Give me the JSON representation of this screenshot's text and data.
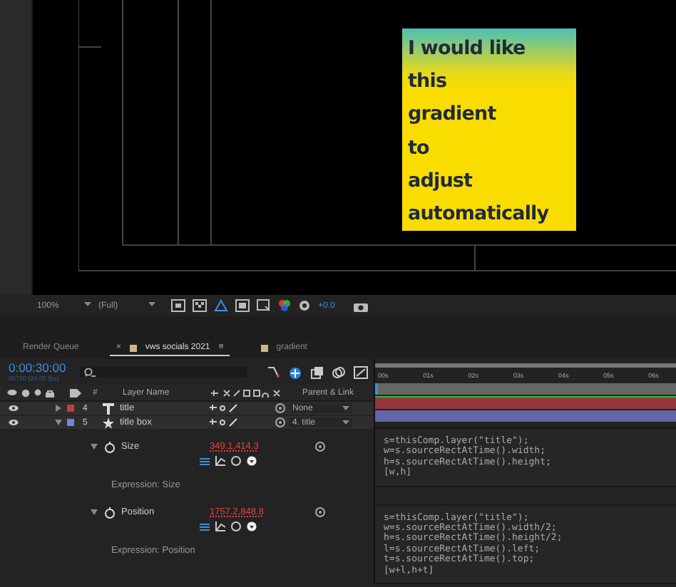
{
  "canvas": {
    "title_card": {
      "lines": [
        "I would like",
        "this",
        "gradient",
        "to",
        "adjust",
        "automatically"
      ]
    }
  },
  "viewer_bar": {
    "zoom": "100%",
    "resolution": "(Full)",
    "exposure": "+0.0"
  },
  "tabs": [
    {
      "label": "Render Queue",
      "selected": false
    },
    {
      "label": "vws socials 2021",
      "selected": true,
      "close": "×",
      "menu": "≡"
    },
    {
      "label": "gradient",
      "selected": false
    }
  ],
  "timecode": "0:00:30:00",
  "frame_info": "00720 (24.00 fps)",
  "columns": [
    "#",
    "Layer Name",
    "Parent & Link"
  ],
  "ruler": [
    "00s",
    "01s",
    "02s",
    "03s",
    "04s",
    "05s",
    "06s"
  ],
  "layers": [
    {
      "number": "4",
      "kind": "text",
      "name": "title",
      "parent": "None",
      "color": "#c8393f",
      "expanded": false
    },
    {
      "number": "5",
      "kind": "shape",
      "name": "title box",
      "parent": "4. title",
      "color": "#7b80e6",
      "expanded": true,
      "properties": [
        {
          "name": "Size",
          "value": "349.1,414.3",
          "expression_label": "Expression: Size",
          "expression": [
            "s=thisComp.layer(\"title\");",
            "w=s.sourceRectAtTime().width;",
            "h=s.sourceRectAtTime().height;",
            "[w,h]"
          ]
        },
        {
          "name": "Position",
          "value": "1757.2,848.8",
          "expression_label": "Expression: Position",
          "expression": [
            "s=thisComp.layer(\"title\");",
            "w=s.sourceRectAtTime().width/2;",
            "h=s.sourceRectAtTime().height/2;",
            "l=s.sourceRectAtTime().left;",
            "t=s.sourceRectAtTime().top;",
            "[w+l,h+t]"
          ]
        }
      ]
    }
  ]
}
